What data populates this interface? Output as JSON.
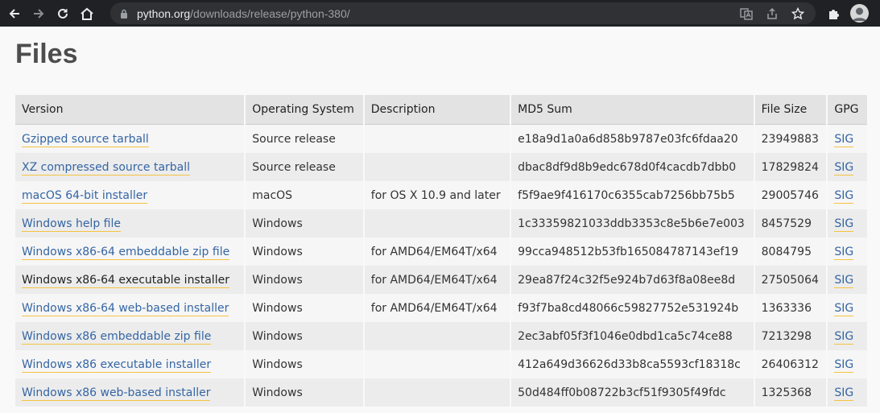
{
  "browser": {
    "url_host": "python.org",
    "url_path": "/downloads/release/python-380/",
    "icons": {
      "back": "arrow-left-icon",
      "forward": "arrow-right-icon",
      "reload": "reload-icon",
      "home": "home-icon",
      "lock": "lock-icon",
      "translate": "translate-icon",
      "share": "share-icon",
      "bookmark": "star-icon",
      "extensions": "puzzle-icon",
      "profile": "avatar-icon"
    }
  },
  "page": {
    "title": "Files"
  },
  "table": {
    "headers": {
      "version": "Version",
      "os": "Operating System",
      "description": "Description",
      "md5": "MD5 Sum",
      "size": "File Size",
      "gpg": "GPG"
    },
    "rows": [
      {
        "version": "Gzipped source tarball",
        "os": "Source release",
        "description": "",
        "md5": "e18a9d1a0a6d858b9787e03fc6fdaa20",
        "size": "23949883",
        "gpg": "SIG"
      },
      {
        "version": "XZ compressed source tarball",
        "os": "Source release",
        "description": "",
        "md5": "dbac8df9d8b9edc678d0f4cacdb7dbb0",
        "size": "17829824",
        "gpg": "SIG"
      },
      {
        "version": "macOS 64-bit installer",
        "os": "macOS",
        "description": "for OS X 10.9 and later",
        "md5": "f5f9ae9f416170c6355cab7256bb75b5",
        "size": "29005746",
        "gpg": "SIG"
      },
      {
        "version": "Windows help file",
        "os": "Windows",
        "description": "",
        "md5": "1c33359821033ddb3353c8e5b6e7e003",
        "size": "8457529",
        "gpg": "SIG"
      },
      {
        "version": "Windows x86-64 embeddable zip file",
        "os": "Windows",
        "description": "for AMD64/EM64T/x64",
        "md5": "99cca948512b53fb165084787143ef19",
        "size": "8084795",
        "gpg": "SIG"
      },
      {
        "version": "Windows x86-64 executable installer",
        "os": "Windows",
        "description": "for AMD64/EM64T/x64",
        "md5": "29ea87f24c32f5e924b7d63f8a08ee8d",
        "size": "27505064",
        "gpg": "SIG"
      },
      {
        "version": "Windows x86-64 web-based installer",
        "os": "Windows",
        "description": "for AMD64/EM64T/x64",
        "md5": "f93f7ba8cd48066c59827752e531924b",
        "size": "1363336",
        "gpg": "SIG"
      },
      {
        "version": "Windows x86 embeddable zip file",
        "os": "Windows",
        "description": "",
        "md5": "2ec3abf05f3f1046e0dbd1ca5c74ce88",
        "size": "7213298",
        "gpg": "SIG"
      },
      {
        "version": "Windows x86 executable installer",
        "os": "Windows",
        "description": "",
        "md5": "412a649d36626d33b8ca5593cf18318c",
        "size": "26406312",
        "gpg": "SIG"
      },
      {
        "version": "Windows x86 web-based installer",
        "os": "Windows",
        "description": "",
        "md5": "50d484ff0b08722b3cf51f9305f49fdc",
        "size": "1325368",
        "gpg": "SIG"
      }
    ]
  },
  "colors": {
    "link": "#3465a4",
    "link_underline": "#f3c340",
    "header_bg": "#e3e3e3",
    "toolbar_bg": "#202124"
  }
}
